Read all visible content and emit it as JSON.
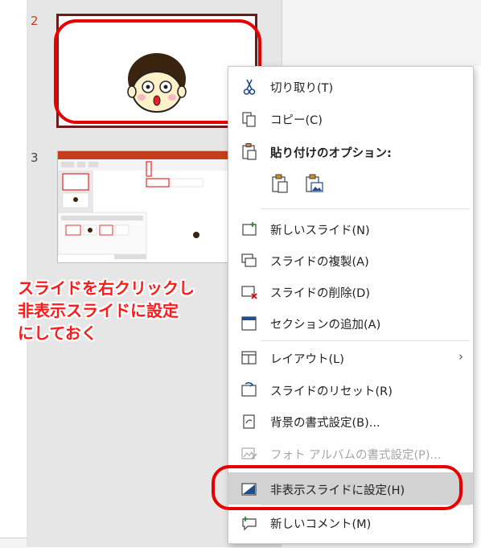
{
  "slides": [
    {
      "number": "2"
    },
    {
      "number": "3"
    }
  ],
  "annotation": {
    "lines": [
      "スライドを右クリックし",
      "非表示スライドに設定",
      "にしておく"
    ]
  },
  "context_menu": {
    "cut": "切り取り(T)",
    "copy": "コピー(C)",
    "paste_options": "貼り付けのオプション:",
    "new_slide": "新しいスライド(N)",
    "duplicate_slide": "スライドの複製(A)",
    "delete_slide": "スライドの削除(D)",
    "add_section": "セクションの追加(A)",
    "layout": "レイアウト(L)",
    "reset_slide": "スライドのリセット(R)",
    "format_background": "背景の書式設定(B)...",
    "format_photo_album": "フォト アルバムの書式設定(P)...",
    "hide_slide": "非表示スライドに設定(H)",
    "new_comment": "新しいコメント(M)"
  },
  "colors": {
    "accent_red": "#e60000",
    "active_slide_border": "#6b1d1d",
    "hover_bg": "#d2d2d2"
  }
}
